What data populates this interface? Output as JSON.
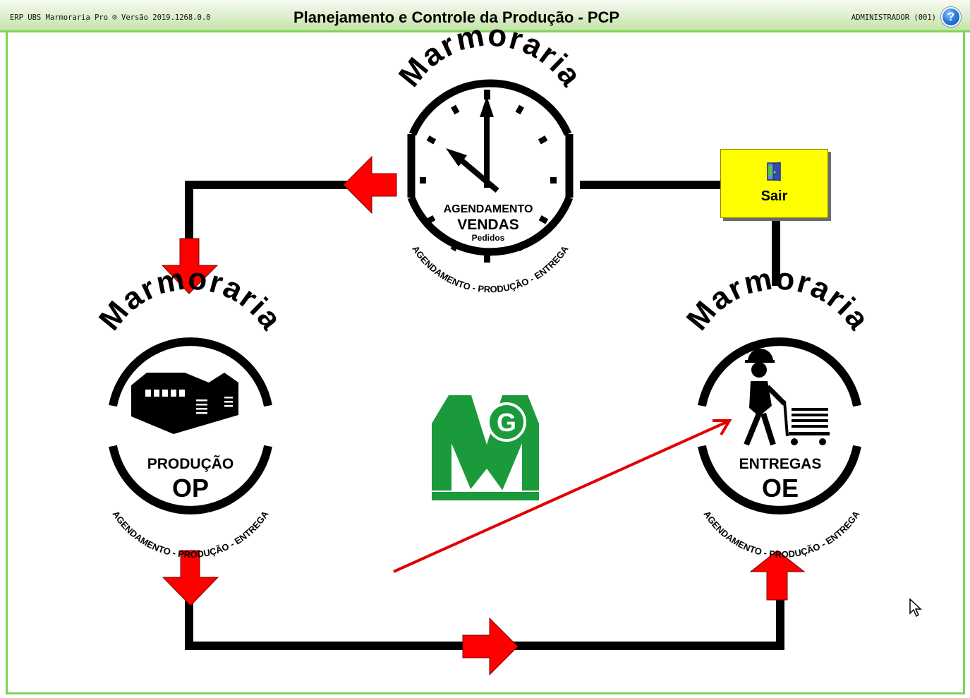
{
  "header": {
    "app_version": "ERP UBS Marmoraria Pro ® Versão 2019.1268.0.0",
    "title": "Planejamento e Controle da Produção - PCP",
    "user": "ADMINISTRADOR (001)",
    "help_symbol": "?"
  },
  "modules": {
    "vendas": {
      "arc_title": "Marmoraria",
      "heading": "AGENDAMENTO",
      "code": "VENDAS",
      "sub": "Pedidos",
      "ring_text": "AGENDAMENTO - PRODUÇÃO - ENTREGA",
      "icon": "clock-icon"
    },
    "producao": {
      "arc_title": "Marmoraria",
      "heading": "PRODUÇÃO",
      "code": "OP",
      "ring_text": "AGENDAMENTO - PRODUÇÃO - ENTREGA",
      "icon": "factory-icon"
    },
    "entregas": {
      "arc_title": "Marmoraria",
      "heading": "ENTREGAS",
      "code": "OE",
      "ring_text": "AGENDAMENTO - PRODUÇÃO - ENTREGA",
      "icon": "delivery-worker-icon"
    }
  },
  "exit_button": {
    "label": "Sair",
    "icon": "exit-door-icon"
  },
  "logo": {
    "text": "MG"
  },
  "colors": {
    "title_green": "#7fd35a",
    "arrow_red": "#ff0000",
    "exit_yellow": "#ffff00",
    "logo_green": "#1a9a3a",
    "flow_line": "#000000"
  }
}
